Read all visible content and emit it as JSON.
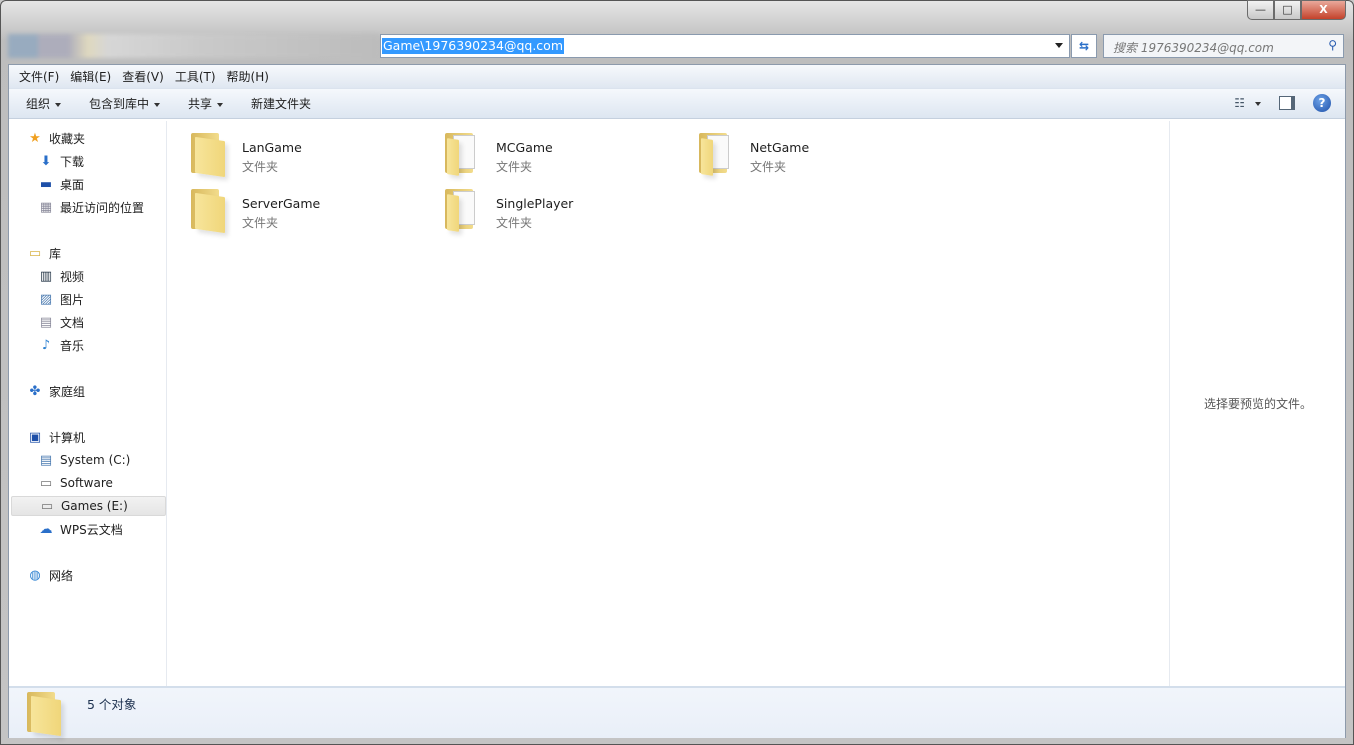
{
  "window": {
    "address": "Game\\1976390234@qq.com",
    "search_placeholder": "搜索 1976390234@qq.com",
    "minimize": "—",
    "maximize": "□",
    "close": "X"
  },
  "menu": [
    "文件(F)",
    "编辑(E)",
    "查看(V)",
    "工具(T)",
    "帮助(H)"
  ],
  "toolbar": {
    "organize": "组织",
    "include": "包含到库中",
    "share": "共享",
    "new_folder": "新建文件夹"
  },
  "nav": [
    {
      "label": "收藏夹",
      "icon": "star-icon",
      "indent": 0
    },
    {
      "label": "下载",
      "icon": "download-folder-icon",
      "indent": 1
    },
    {
      "label": "桌面",
      "icon": "desktop-icon",
      "indent": 1
    },
    {
      "label": "最近访问的位置",
      "icon": "recent-places-icon",
      "indent": 1
    },
    {
      "label": "库",
      "icon": "library-icon",
      "indent": 0
    },
    {
      "label": "视频",
      "icon": "video-icon",
      "indent": 1
    },
    {
      "label": "图片",
      "icon": "picture-icon",
      "indent": 1
    },
    {
      "label": "文档",
      "icon": "document-icon",
      "indent": 1
    },
    {
      "label": "音乐",
      "icon": "music-icon",
      "indent": 1
    },
    {
      "label": "家庭组",
      "icon": "homegroup-icon",
      "indent": 0
    },
    {
      "label": "计算机",
      "icon": "computer-icon",
      "indent": 0
    },
    {
      "label": "System (C:)",
      "icon": "system-drive-icon",
      "indent": 1
    },
    {
      "label": "Software",
      "icon": "drive-icon",
      "indent": 1
    },
    {
      "label": "Games (E:)",
      "icon": "drive-icon",
      "indent": 1,
      "selected": true
    },
    {
      "label": "WPS云文档",
      "icon": "cloud-icon",
      "indent": 1
    },
    {
      "label": "网络",
      "icon": "network-icon",
      "indent": 0
    }
  ],
  "files": [
    {
      "name": "LanGame",
      "type": "文件夹",
      "has_docs": false
    },
    {
      "name": "MCGame",
      "type": "文件夹",
      "has_docs": true
    },
    {
      "name": "NetGame",
      "type": "文件夹",
      "has_docs": true
    },
    {
      "name": "ServerGame",
      "type": "文件夹",
      "has_docs": false
    },
    {
      "name": "SinglePlayer",
      "type": "文件夹",
      "has_docs": true
    }
  ],
  "preview": {
    "message": "选择要预览的文件。"
  },
  "status": {
    "count": "5 个对象"
  }
}
